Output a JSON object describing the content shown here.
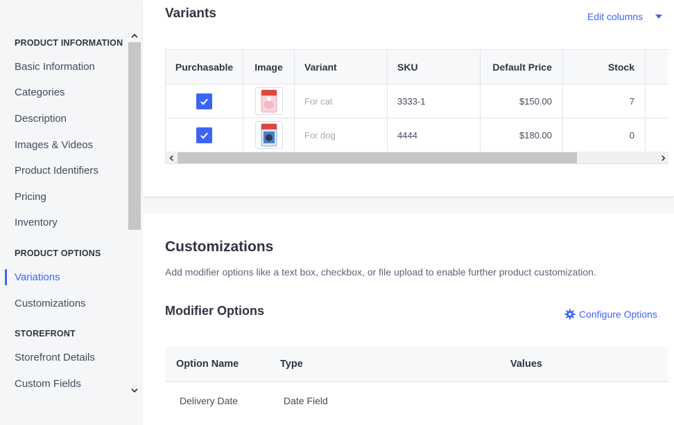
{
  "sidebar": {
    "groups": {
      "product_information": "PRODUCT INFORMATION",
      "product_options": "PRODUCT OPTIONS",
      "storefront": "STOREFRONT"
    },
    "items": {
      "basic_information": "Basic Information",
      "categories": "Categories",
      "description": "Description",
      "images_videos": "Images & Videos",
      "product_identifiers": "Product Identifiers",
      "pricing": "Pricing",
      "inventory": "Inventory",
      "variations": "Variations",
      "customizations": "Customizations",
      "storefront_details": "Storefront Details",
      "custom_fields": "Custom Fields"
    },
    "active_item": "variations"
  },
  "variants": {
    "title": "Variants",
    "edit_columns": "Edit columns",
    "columns": {
      "purchasable": "Purchasable",
      "image": "Image",
      "variant": "Variant",
      "sku": "SKU",
      "default_price": "Default Price",
      "stock": "Stock"
    },
    "rows": [
      {
        "purchasable": true,
        "image": "cat-food-package",
        "variant": "For cat",
        "sku": "3333-1",
        "default_price": "$150.00",
        "stock": "7"
      },
      {
        "purchasable": true,
        "image": "dog-food-package",
        "variant": "For dog",
        "sku": "4444",
        "default_price": "$180.00",
        "stock": "0"
      }
    ]
  },
  "customizations": {
    "title": "Customizations",
    "description": "Add modifier options like a text box, checkbox, or file upload to enable further product customization.",
    "modifier_title": "Modifier Options",
    "configure_label": "Configure Options",
    "columns": {
      "option_name": "Option Name",
      "type": "Type",
      "values": "Values"
    },
    "rows": [
      {
        "option_name": "Delivery Date",
        "type": "Date Field",
        "values": ""
      }
    ]
  },
  "colors": {
    "accent": "#3c64f4",
    "text": "#313440",
    "border": "#dfe3ea",
    "cat_package": "#f2b8c6",
    "dog_package": "#4a7fc1"
  }
}
